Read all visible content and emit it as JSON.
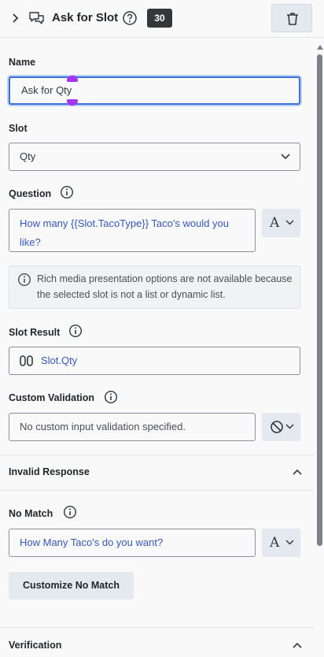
{
  "header": {
    "title": "Ask for Slot",
    "count_badge": "30",
    "icons": [
      "chevron-right-icon",
      "chat-bubbles-icon",
      "help-circle-icon",
      "trash-icon"
    ]
  },
  "name": {
    "label": "Name",
    "value": "Ask for Qty"
  },
  "slot": {
    "label": "Slot",
    "selected": "Qty"
  },
  "question": {
    "label": "Question",
    "value": "How many {{Slot.TacoType}} Taco's would you like?"
  },
  "info_message": "Rich media presentation options are not available because the selected slot is not a list or dynamic list.",
  "slot_result": {
    "label": "Slot Result",
    "value": "Slot.Qty"
  },
  "custom_validation": {
    "label": "Custom Validation",
    "placeholder": "No custom input validation specified."
  },
  "invalid_response": {
    "title": "Invalid Response"
  },
  "no_match": {
    "label": "No Match",
    "value": "How Many Taco's do you want?",
    "button_label": "Customize No Match"
  },
  "verification": {
    "title": "Verification"
  },
  "colors": {
    "accent_blue": "#3b6fd9",
    "link_text": "#3757b4",
    "badge_bg": "#33383d",
    "focus_marker": "#a533f0"
  }
}
